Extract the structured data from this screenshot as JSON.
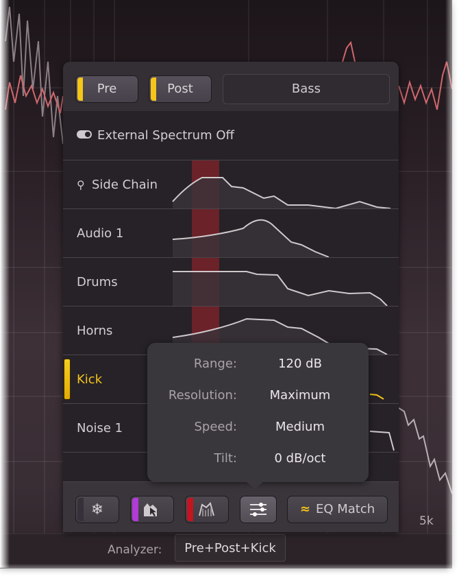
{
  "background": {
    "frequency_label": "5k",
    "analyzer_label": "Analyzer:",
    "analyzer_value": "Pre+Post+Kick"
  },
  "panel": {
    "top_buttons": [
      {
        "label": "Pre",
        "active": true,
        "led_color": "#f5c518"
      },
      {
        "label": "Post",
        "active": true,
        "led_color": "#f5c518"
      }
    ],
    "source_field": "Bass",
    "external_spectrum": {
      "label": "External Spectrum Off",
      "icon": "toggle-icon"
    },
    "sources": [
      {
        "label": "Side Chain",
        "icon": "sidechain-icon",
        "selected": false
      },
      {
        "label": "Audio 1",
        "selected": false
      },
      {
        "label": "Drums",
        "selected": false
      },
      {
        "label": "Horns",
        "selected": false
      },
      {
        "label": "Kick",
        "selected": true
      },
      {
        "label": "Noise 1",
        "selected": false
      }
    ],
    "colors": {
      "accent": "#f5c518",
      "highlight_band": "#c0242c",
      "purple_led": "#b23ad8",
      "red_led": "#c4141f"
    }
  },
  "popup": {
    "properties": [
      {
        "label": "Range:",
        "value": "120 dB"
      },
      {
        "label": "Resolution:",
        "value": "Maximum"
      },
      {
        "label": "Speed:",
        "value": "Medium"
      },
      {
        "label": "Tilt:",
        "value": "0 dB/oct"
      }
    ]
  },
  "toolbar": {
    "freeze": {
      "icon": "snowflake-icon"
    },
    "draw": {
      "icon": "spectrum-grab-icon",
      "led_color": "#b23ad8"
    },
    "peak": {
      "icon": "peak-hold-icon",
      "led_color": "#c4141f"
    },
    "settings": {
      "icon": "sliders-icon"
    },
    "eq_match": {
      "icon": "approx-icon",
      "icon_glyph": "≈",
      "label": "EQ Match"
    }
  }
}
